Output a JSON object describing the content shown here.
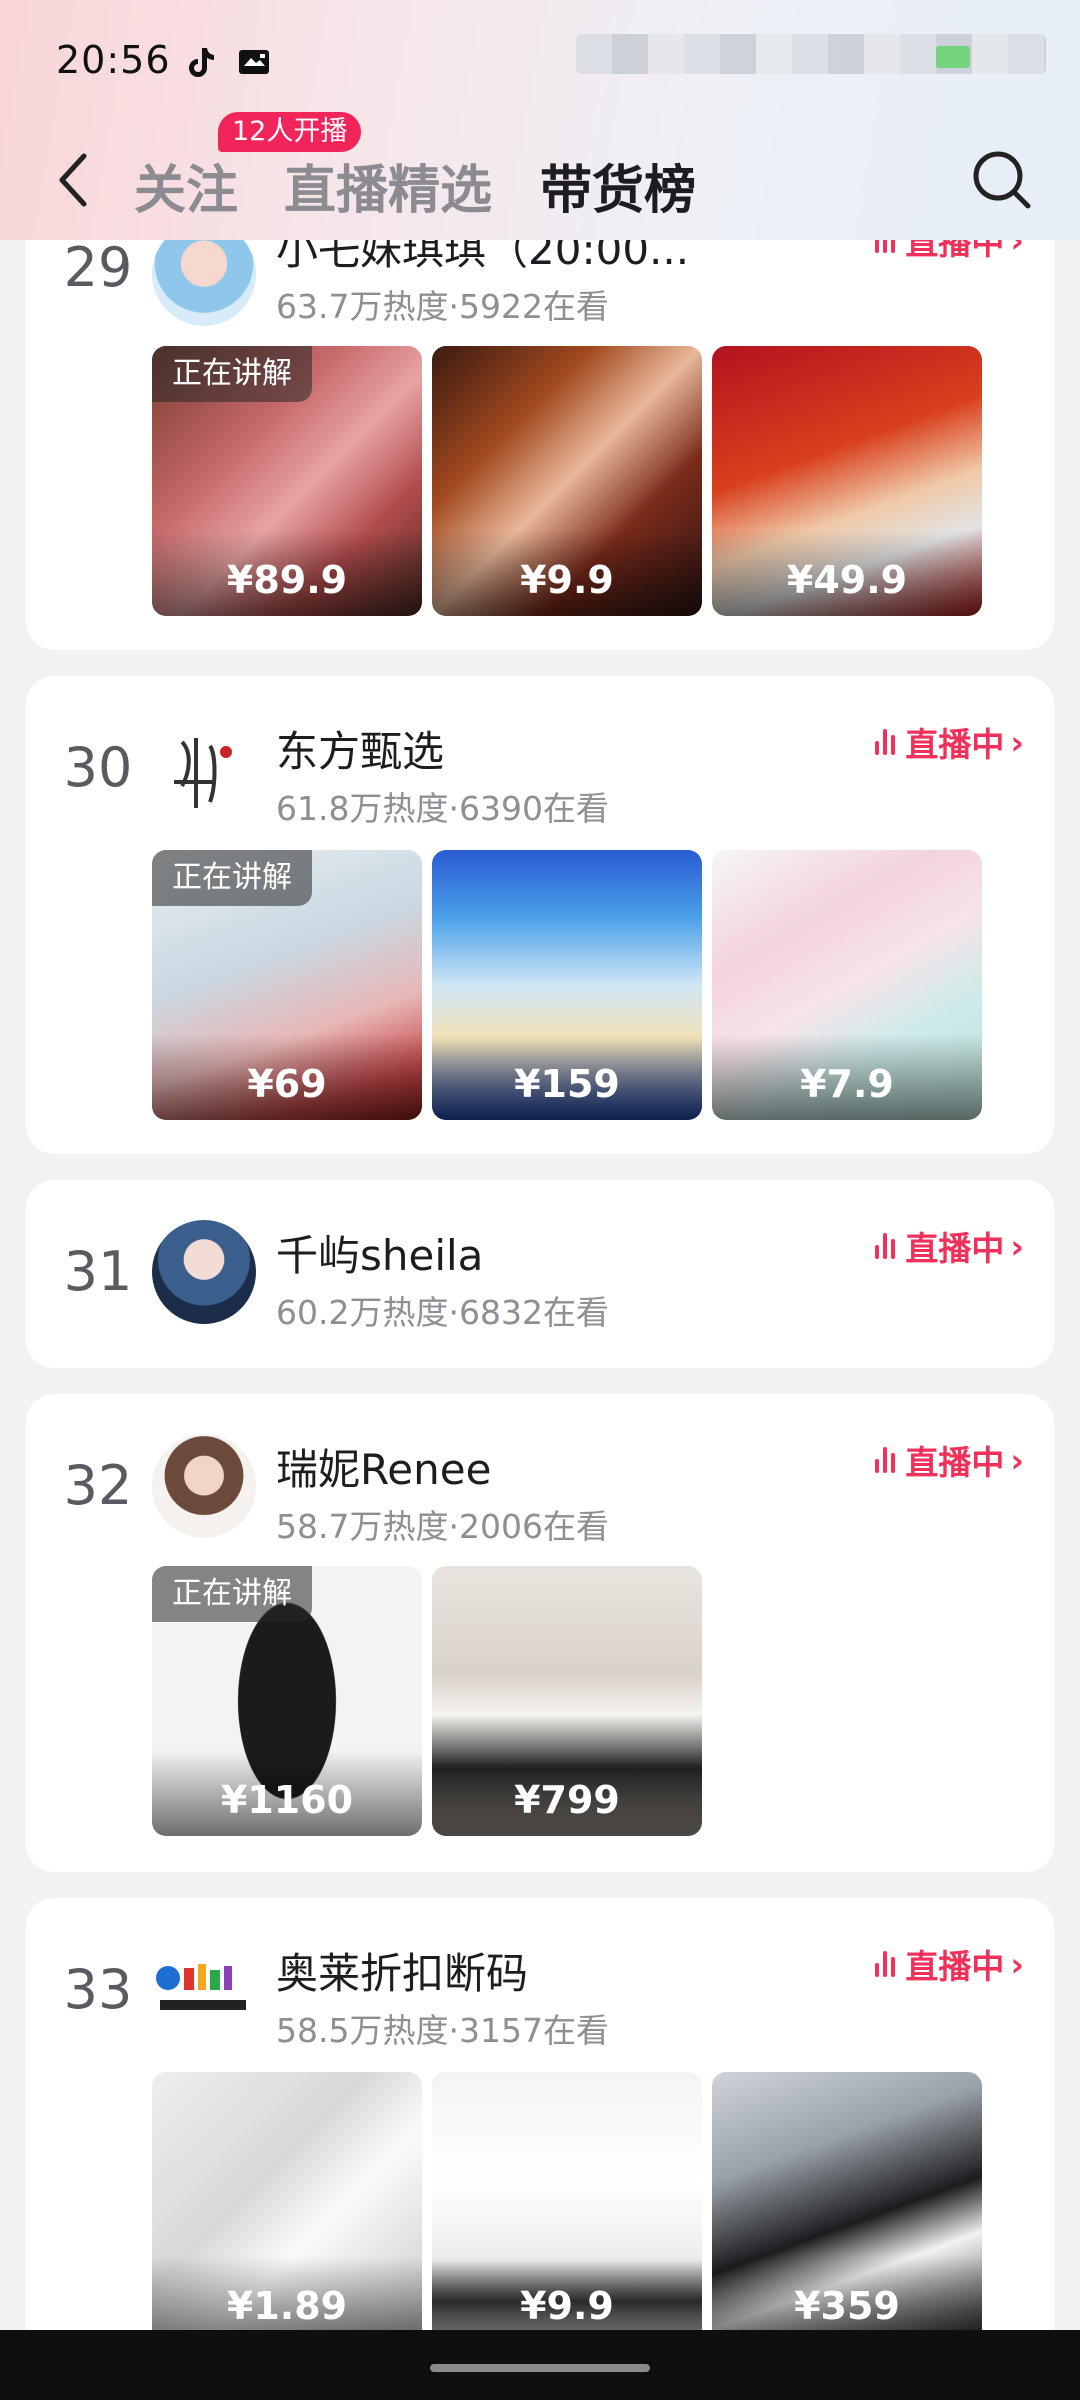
{
  "status_bar": {
    "time": "20:56"
  },
  "nav": {
    "tabs": [
      {
        "label": "关注",
        "active": false
      },
      {
        "label": "直播精选",
        "active": false
      },
      {
        "label": "带货榜",
        "active": true
      }
    ],
    "badge": "12人开播"
  },
  "live_label": "直播中",
  "explaining_label": "正在讲解",
  "ranking": [
    {
      "rank": "29",
      "name": "小乇妹琪琪（20:00...",
      "stats": "63.7万热度·5922在看",
      "products": [
        {
          "price": "¥89.9",
          "explaining": true
        },
        {
          "price": "¥9.9",
          "explaining": false
        },
        {
          "price": "¥49.9",
          "explaining": false
        }
      ]
    },
    {
      "rank": "30",
      "name": "东方甄选",
      "stats": "61.8万热度·6390在看",
      "products": [
        {
          "price": "¥69",
          "explaining": true
        },
        {
          "price": "¥159",
          "explaining": false
        },
        {
          "price": "¥7.9",
          "explaining": false
        }
      ]
    },
    {
      "rank": "31",
      "name": "千屿sheila",
      "stats": "60.2万热度·6832在看",
      "products": []
    },
    {
      "rank": "32",
      "name": "瑞妮Renee",
      "stats": "58.7万热度·2006在看",
      "products": [
        {
          "price": "¥1160",
          "explaining": true
        },
        {
          "price": "¥799",
          "explaining": false
        }
      ]
    },
    {
      "rank": "33",
      "name": "奥莱折扣断码",
      "stats": "58.5万热度·3157在看",
      "products": [
        {
          "price": "¥1.89",
          "explaining": false
        },
        {
          "price": "¥9.9",
          "explaining": false
        },
        {
          "price": "¥359",
          "explaining": false
        }
      ]
    }
  ],
  "colors": {
    "accent": "#f2315b",
    "badge": "#f2255a",
    "rank": "#5a5a60"
  }
}
